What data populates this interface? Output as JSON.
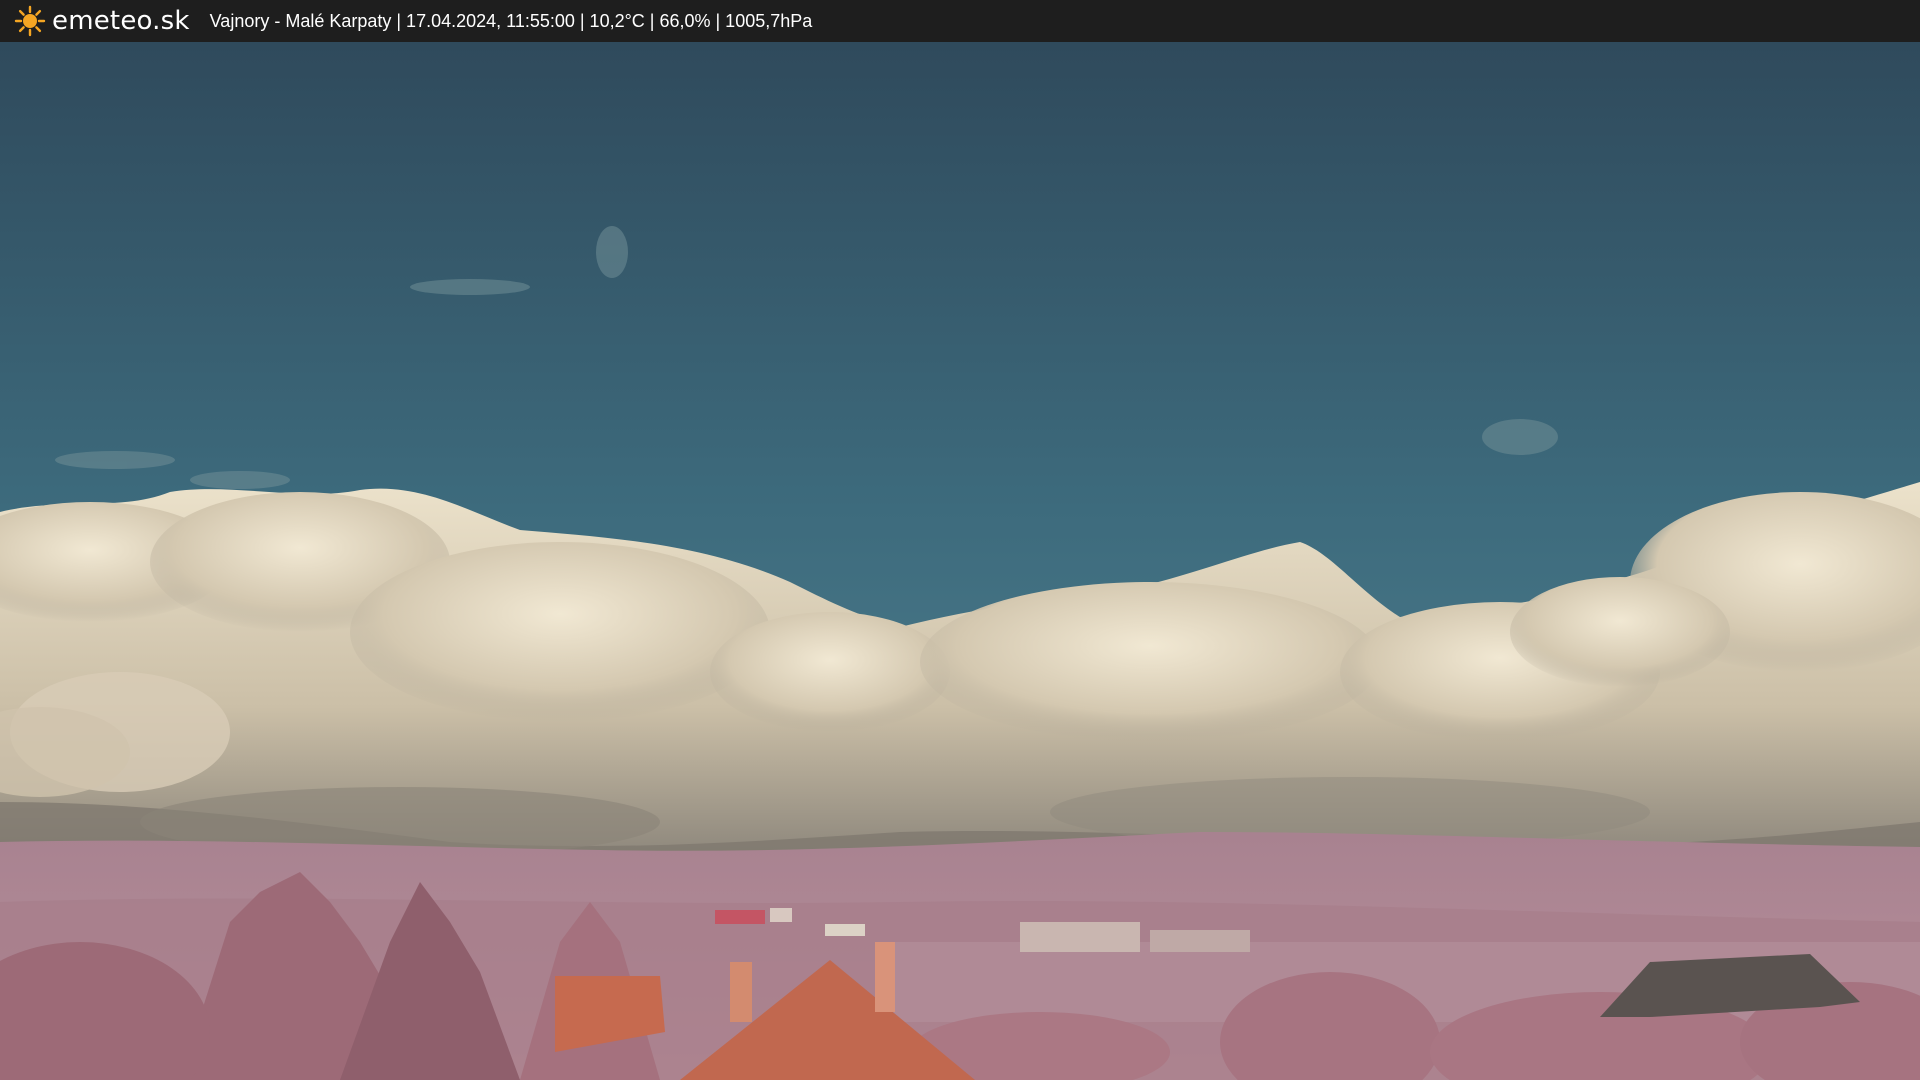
{
  "header": {
    "brand": "emeteo.sk",
    "status": "Vajnory - Malé Karpaty | 17.04.2024, 11:55:00 | 10,2°C | 66,0% | 1005,7hPa",
    "logo_icon": "sun-icon",
    "logo_color": "#f5a623",
    "background": "#1e1e1e"
  },
  "scene": {
    "colors": {
      "sky_top": "#2f4c5e",
      "sky_bottom": "#4f8090",
      "cloud_light": "#e8dcc4",
      "cloud_shadow": "#8d8678",
      "hills": "#b48a96",
      "foliage": "#a06b78",
      "roof": "#c46a4e"
    }
  }
}
